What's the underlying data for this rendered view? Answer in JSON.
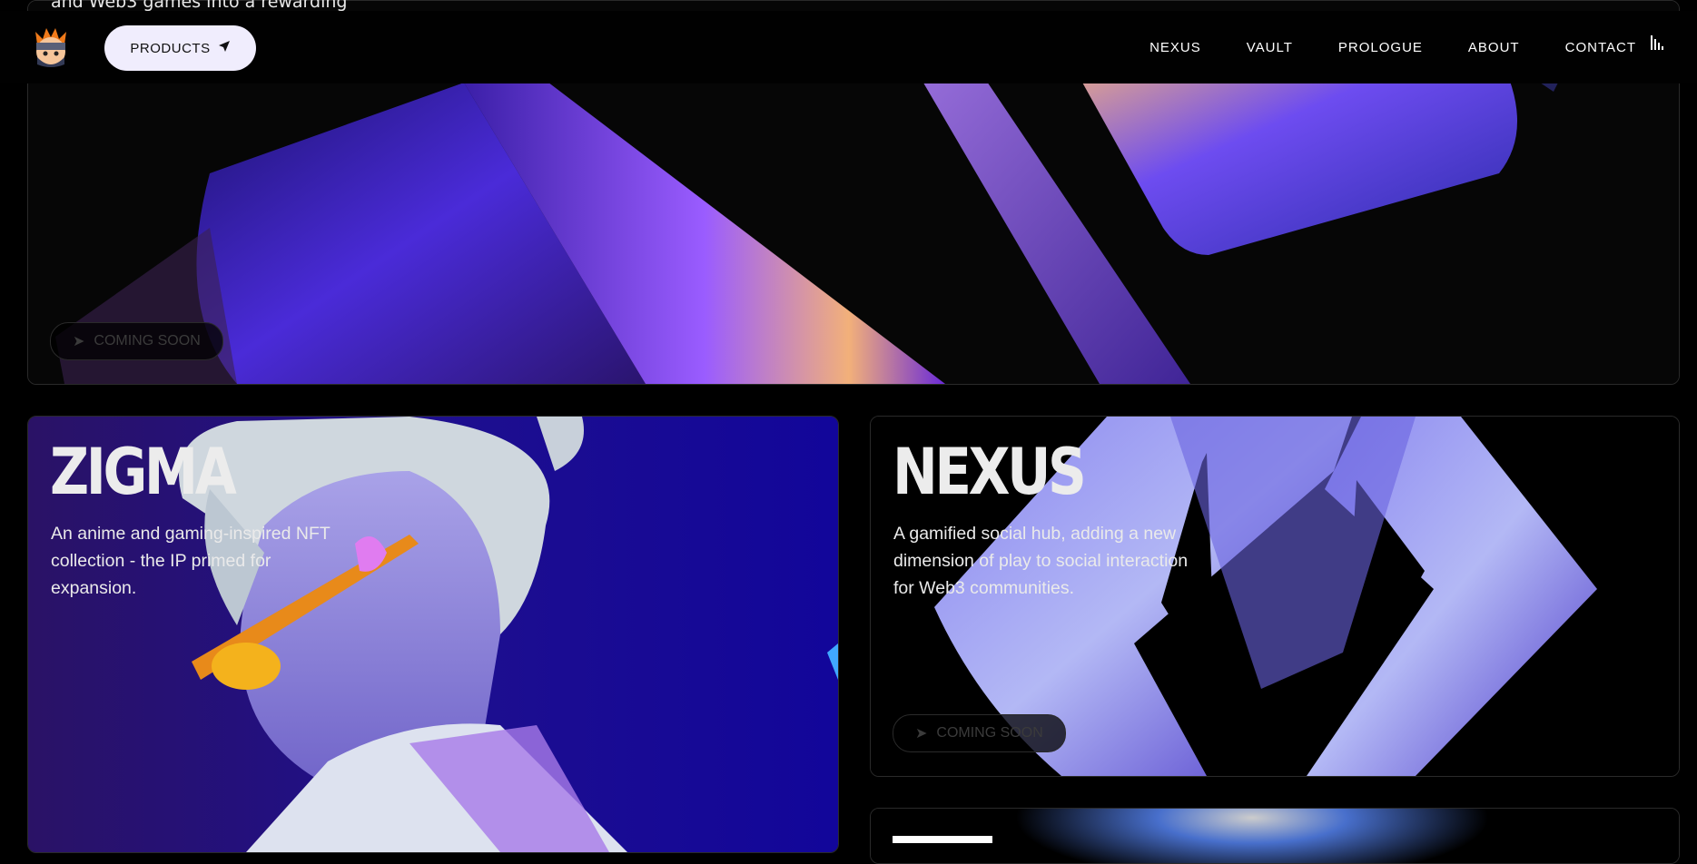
{
  "top_text": "and Web3 games into a rewarding",
  "nav": {
    "products_label": "PRODUCTS",
    "links": [
      "NEXUS",
      "VAULT",
      "PROLOGUE",
      "ABOUT",
      "CONTACT"
    ]
  },
  "hero": {
    "badge": "COMING SOON"
  },
  "cards": {
    "zigma": {
      "title": "ZIGMA",
      "description": "An anime and gaming-inspired NFT collection - the IP primed for expansion."
    },
    "nexus": {
      "title": "NEXUS",
      "description": "A gamified social hub, adding a new dimension of play to social interaction for Web3 communities.",
      "badge": "COMING SOON"
    }
  },
  "icons": {
    "logo": "ninja-avatar-icon",
    "products": "paper-plane-icon",
    "audio": "sound-bars-icon",
    "badge": "arrow-icon"
  },
  "colors": {
    "background": "#000000",
    "products_button": "#f0edfd",
    "accent_purple": "#6a3cff"
  }
}
